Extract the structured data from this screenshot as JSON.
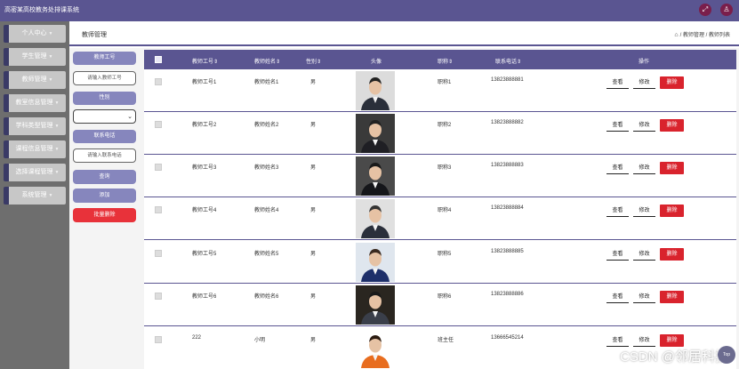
{
  "app": {
    "title": "高密某高校教务处排课系统"
  },
  "topbar_icons": [
    "fullscreen-icon",
    "user-icon"
  ],
  "sidebar": {
    "items": [
      {
        "label": "个人中心"
      },
      {
        "label": "学生管理"
      },
      {
        "label": "教师管理"
      },
      {
        "label": "教室信息管理"
      },
      {
        "label": "学科类型管理"
      },
      {
        "label": "课程信息管理"
      },
      {
        "label": "选择课程管理"
      },
      {
        "label": "系统管理"
      }
    ]
  },
  "header": {
    "title": "教师管理",
    "breadcrumb": [
      "教师管理",
      "教师列表"
    ]
  },
  "filters": {
    "teacher_id_label": "教师工号",
    "teacher_id_placeholder": "请输入教师工号",
    "gender_label": "性别",
    "gender_value": "",
    "phone_label": "联系电话",
    "phone_placeholder": "请输入联系电话",
    "query_button": "查询",
    "add_button": "添加",
    "batch_delete_button": "批量删除"
  },
  "table": {
    "columns": [
      "教师工号",
      "教师姓名",
      "性别",
      "头像",
      "职称",
      "联系电话",
      "操作"
    ],
    "actions": {
      "view": "查看",
      "edit": "修改",
      "delete": "删除"
    },
    "rows": [
      {
        "id": "教师工号1",
        "name": "教师姓名1",
        "gender": "男",
        "title": "职称1",
        "phone": "13823888881"
      },
      {
        "id": "教师工号2",
        "name": "教师姓名2",
        "gender": "男",
        "title": "职称2",
        "phone": "13823888882"
      },
      {
        "id": "教师工号3",
        "name": "教师姓名3",
        "gender": "男",
        "title": "职称3",
        "phone": "13823888883"
      },
      {
        "id": "教师工号4",
        "name": "教师姓名4",
        "gender": "男",
        "title": "职称4",
        "phone": "13823888884"
      },
      {
        "id": "教师工号5",
        "name": "教师姓名5",
        "gender": "男",
        "title": "职称5",
        "phone": "13823888885"
      },
      {
        "id": "教师工号6",
        "name": "教师姓名6",
        "gender": "男",
        "title": "职称6",
        "phone": "13823888886"
      },
      {
        "id": "222",
        "name": "小明",
        "gender": "男",
        "title": "班主任",
        "phone": "13666545214"
      }
    ]
  },
  "watermark": "CSDN @邻居科技",
  "scroll_top": "Top",
  "colors": {
    "primary": "#5a5591",
    "danger": "#d9232d",
    "sidebar_bg": "#6e6e6e"
  }
}
